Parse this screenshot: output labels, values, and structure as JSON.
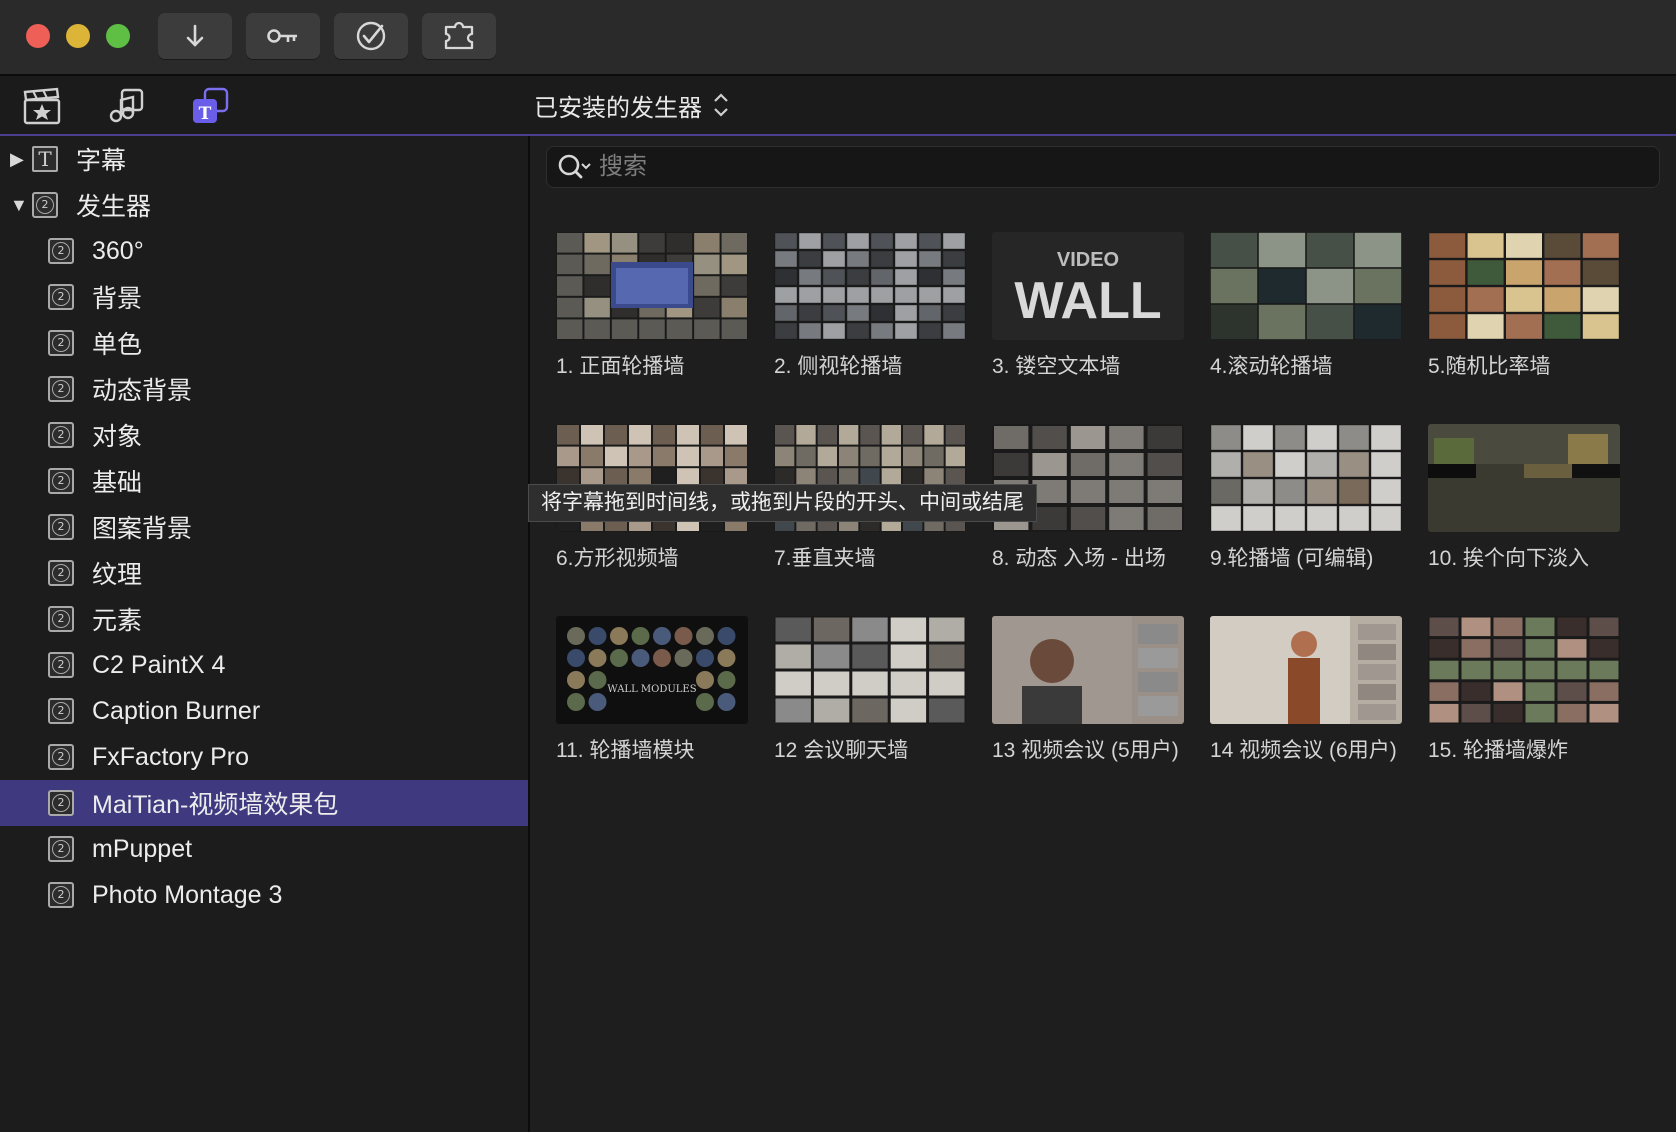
{
  "toolbar": {
    "buttons": [
      {
        "icon": "download-arrow-icon"
      },
      {
        "icon": "key-icon"
      },
      {
        "icon": "checkmark-circle-icon"
      },
      {
        "icon": "puzzle-icon"
      }
    ]
  },
  "browser": {
    "tabs": [
      {
        "icon": "clapper-star-icon",
        "active": false
      },
      {
        "icon": "music-photo-icon",
        "active": false
      },
      {
        "icon": "titles-generators-icon",
        "active": true
      }
    ],
    "view_menu": "已安装的发生器"
  },
  "sidebar": {
    "items": [
      {
        "label": "字幕",
        "level": 0,
        "disclosure": "▶",
        "icon": "T"
      },
      {
        "label": "发生器",
        "level": 0,
        "disclosure": "▼",
        "icon": "2"
      },
      {
        "label": "360°",
        "level": 1,
        "icon": "2"
      },
      {
        "label": "背景",
        "level": 1,
        "icon": "2"
      },
      {
        "label": "单色",
        "level": 1,
        "icon": "2"
      },
      {
        "label": "动态背景",
        "level": 1,
        "icon": "2"
      },
      {
        "label": "对象",
        "level": 1,
        "icon": "2"
      },
      {
        "label": "基础",
        "level": 1,
        "icon": "2"
      },
      {
        "label": "图案背景",
        "level": 1,
        "icon": "2"
      },
      {
        "label": "纹理",
        "level": 1,
        "icon": "2"
      },
      {
        "label": "元素",
        "level": 1,
        "icon": "2"
      },
      {
        "label": "C2 PaintX 4",
        "level": 1,
        "icon": "2"
      },
      {
        "label": "Caption Burner",
        "level": 1,
        "icon": "2"
      },
      {
        "label": "FxFactory Pro",
        "level": 1,
        "icon": "2"
      },
      {
        "label": "MaiTian-视频墙效果包",
        "level": 1,
        "icon": "2",
        "selected": true
      },
      {
        "label": "mPuppet",
        "level": 1,
        "icon": "2"
      },
      {
        "label": "Photo Montage 3",
        "level": 1,
        "icon": "2"
      }
    ]
  },
  "search": {
    "placeholder": "搜索",
    "value": ""
  },
  "tiles": [
    {
      "label": "1. 正面轮播墙"
    },
    {
      "label": "2. 侧视轮播墙"
    },
    {
      "label": "3. 镂空文本墙",
      "thumb_text_top": "VIDEO",
      "thumb_text_main": "WALL"
    },
    {
      "label": "4.滚动轮播墙"
    },
    {
      "label": "5.随机比率墙"
    },
    {
      "label": "6.方形视频墙"
    },
    {
      "label": "7.垂直夹墙"
    },
    {
      "label": "8. 动态 入场 - 出场"
    },
    {
      "label": "9.轮播墙 (可编辑)"
    },
    {
      "label": "10. 挨个向下淡入"
    },
    {
      "label": "11. 轮播墙模块",
      "thumb_text_main": "WALL MODULES"
    },
    {
      "label": "12 会议聊天墙"
    },
    {
      "label": "13 视频会议 (5用户)"
    },
    {
      "label": "14 视频会议 (6用户)"
    },
    {
      "label": "15. 轮播墙爆炸"
    }
  ],
  "tooltip": "将字幕拖到时间线，或拖到片段的开头、中间或结尾"
}
